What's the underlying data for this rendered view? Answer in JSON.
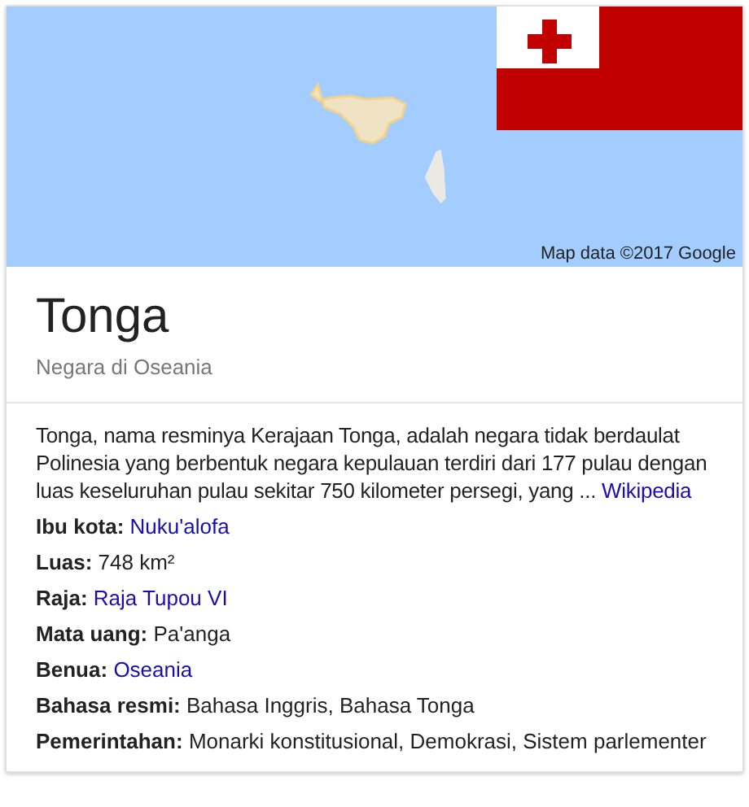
{
  "map": {
    "kind": "picture",
    "attribution": "Map data ©2017 Google"
  },
  "title": "Tonga",
  "subtitle": "Negara di Oseania",
  "description": {
    "text": "Tonga, nama resminya Kerajaan Tonga, adalah negara tidak berdaulat Polinesia yang berbentuk negara kepulauan terdiri dari 177 pulau dengan luas keseluruhan pulau sekitar 750 kilometer persegi, yang ...",
    "source": "Wikipedia"
  },
  "facts": [
    {
      "label": "Ibu kota:",
      "value": "Nuku'alofa",
      "link": true
    },
    {
      "label": "Luas:",
      "value": "748 km²",
      "link": false
    },
    {
      "label": "Raja:",
      "value": "Raja Tupou VI",
      "link": true
    },
    {
      "label": "Mata uang:",
      "value": "Pa'anga",
      "link": false
    },
    {
      "label": "Benua:",
      "value": "Oseania",
      "link": true
    },
    {
      "label": "Bahasa resmi:",
      "value": "Bahasa Inggris, Bahasa Tonga",
      "link": false
    },
    {
      "label": "Pemerintahan:",
      "value": "Monarki konstitusional, Demokrasi, Sistem parlementer",
      "link": false
    }
  ]
}
